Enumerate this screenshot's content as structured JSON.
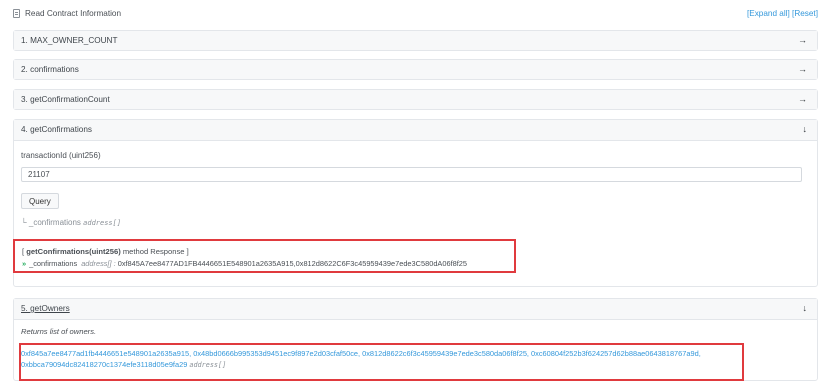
{
  "header": {
    "title": "Read Contract Information",
    "expand_all": "[Expand all]",
    "reset": "[Reset]"
  },
  "functions": [
    {
      "label": "1. MAX_OWNER_COUNT",
      "arrow": "→"
    },
    {
      "label": "2. confirmations",
      "arrow": "→"
    },
    {
      "label": "3. getConfirmationCount",
      "arrow": "→"
    },
    {
      "label": "4. getConfirmations",
      "arrow": "↓"
    },
    {
      "label": "5. getOwners",
      "arrow": "↓"
    }
  ],
  "getConfirmations": {
    "param_label": "transactionId (uint256)",
    "input_value": "21107",
    "query_label": "Query",
    "output_hint_prefix": "└ _confirmations ",
    "output_hint_type": "address[]",
    "response_header_open": "[ ",
    "response_method": "getConfirmations(uint256)",
    "response_header_close": " method Response ]",
    "response_chevron": "»",
    "response_name": "_confirmations",
    "response_type": "address[] :",
    "response_value": "0xf845A7ee8477AD1FB4446651E548901a2635A915,0x812d8622C6F3c45959439e7ede3C580dA06f8f25"
  },
  "getOwners": {
    "description": "Returns list of owners.",
    "owners_line1": "0xf845a7ee8477ad1fb4446651e548901a2635a915, 0x48bd0666b995353d9451ec9f897e2d03cfaf50ce, 0x812d8622c6f3c45959439e7ede3c580da06f8f25, 0xc60804f252b3f624257d62b88ae0643818767a9d,",
    "owners_line2": "0xbbca79094dc82418270c1374efe3118d05e9fa29",
    "owners_type": "address[]"
  }
}
